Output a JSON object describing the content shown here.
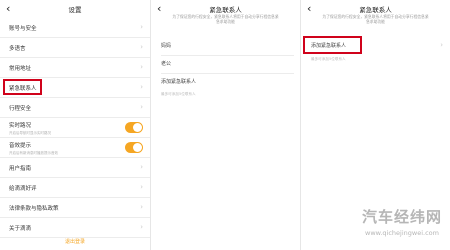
{
  "settings": {
    "title": "设置",
    "items": [
      {
        "label": "账号与安全"
      },
      {
        "label": "多语言"
      },
      {
        "label": "常用地址"
      },
      {
        "label": "紧急联系人"
      },
      {
        "label": "行程安全"
      }
    ],
    "realtime_route": {
      "label": "实时路况",
      "hint": "开启后导航时显示实时路况"
    },
    "voice_assist": {
      "label": "音效提示",
      "hint": "开启后有新消息时播放提示音效"
    },
    "lower_items": [
      {
        "label": "用户指南"
      },
      {
        "label": "给滴滴好评"
      },
      {
        "label": "法律条款与隐私政策"
      },
      {
        "label": "关于滴滴"
      }
    ],
    "logout_label": "退出登录"
  },
  "emergency": {
    "title": "紧急联系人",
    "description": "为了保证您的行程安全，紧急联系人将用于自动分享行程信息紧急求助功能",
    "contacts": [
      "妈妈",
      "老公"
    ],
    "add_label": "添加紧急联系人",
    "add_hint": "最多可添加5位联系人"
  },
  "emergency_empty": {
    "title": "紧急联系人",
    "description": "为了保证您的行程安全，紧急联系人将用于自动分享行程信息紧急求助功能",
    "add_label": "添加紧急联系人",
    "add_hint": "最多可添加5位联系人"
  },
  "watermark": {
    "main": "汽车经纬网",
    "sub": "www.qichejingwei.com"
  },
  "colors": {
    "accent": "#f5a623",
    "highlight": "#d0021b"
  }
}
